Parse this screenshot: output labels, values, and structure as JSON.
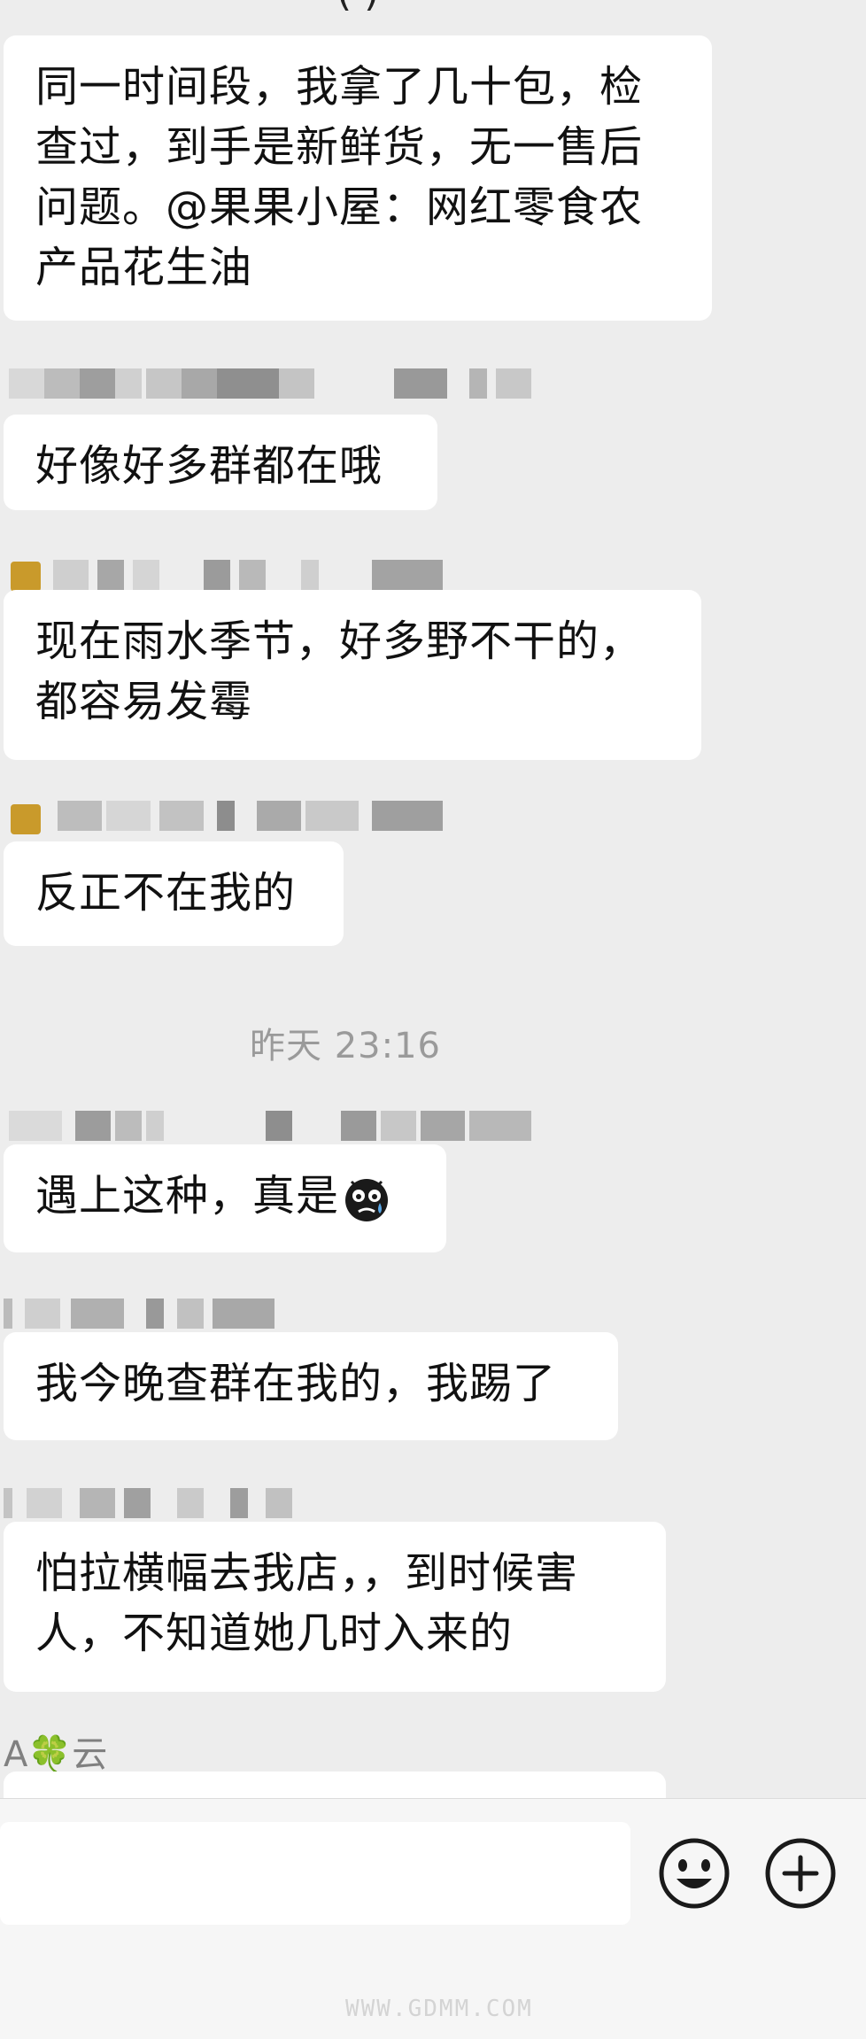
{
  "chat": {
    "top_fragment": "(   )",
    "messages": [
      {
        "lines": [
          "同一时间段，我拿了几十包，检",
          "查过，到手是新鲜货，无一售后",
          "问题。@果果小屋：网红零食农",
          "产品花生油"
        ]
      },
      {
        "lines": [
          "好像好多群都在哦"
        ]
      },
      {
        "lines": [
          "现在雨水季节，好多野不干的，",
          "都容易发霉"
        ]
      },
      {
        "lines": [
          "反正不在我的"
        ]
      },
      {
        "lines": [
          "遇上这种，真是"
        ]
      },
      {
        "lines": [
          "我今晚查群在我的，我踢了"
        ]
      },
      {
        "lines": [
          "怕拉横幅去我店，，到时候害",
          "人，不知道她几时入来的"
        ]
      }
    ],
    "timestamp": "昨天 23:16",
    "last_sender": {
      "prefix": "A",
      "emoji": "🍀",
      "suffix": "云"
    }
  },
  "input_bar": {
    "placeholder": "",
    "emoji_icon": "smiley-face-icon",
    "plus_icon": "plus-circle-icon"
  },
  "watermark": "WWW.GDMM.COM"
}
